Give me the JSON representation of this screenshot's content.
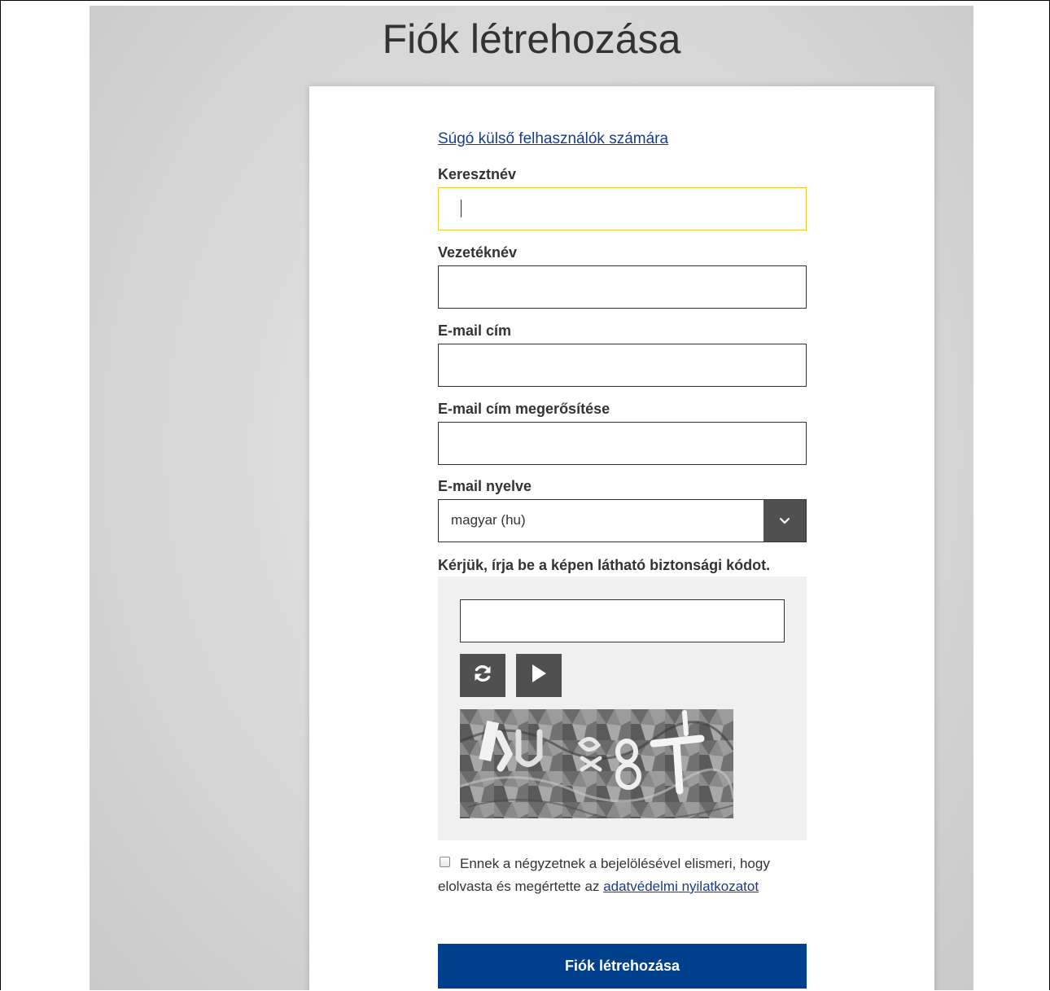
{
  "page": {
    "title": "Fiók létrehozása"
  },
  "form": {
    "help_link": "Súgó külső felhasználók számára",
    "first_name": {
      "label": "Keresztnév",
      "value": ""
    },
    "last_name": {
      "label": "Vezetéknév",
      "value": ""
    },
    "email": {
      "label": "E-mail cím",
      "value": ""
    },
    "email_confirm": {
      "label": "E-mail cím megerősítése",
      "value": ""
    },
    "email_language": {
      "label": "E-mail nyelve",
      "selected": "magyar (hu)"
    },
    "captcha": {
      "label": "Kérjük, írja be a képen látható biztonsági kódot.",
      "value": "",
      "image_text": "ku 8T"
    },
    "consent": {
      "text": "Ennek a négyzetnek a bejelölésével elismeri, hogy elolvasta és megértette az",
      "link": "adatvédelmi nyilatkozatot",
      "checked": false
    },
    "submit_label": "Fiók létrehozása"
  },
  "colors": {
    "primary_button": "#00408d",
    "link": "#1a3a8a",
    "focus_border": "#f3c82e",
    "dark_control": "#505050",
    "backdrop": "#d8d8d8"
  },
  "icons": {
    "select_arrow": "chevron-down-icon",
    "refresh": "refresh-icon",
    "play_audio": "play-icon"
  }
}
